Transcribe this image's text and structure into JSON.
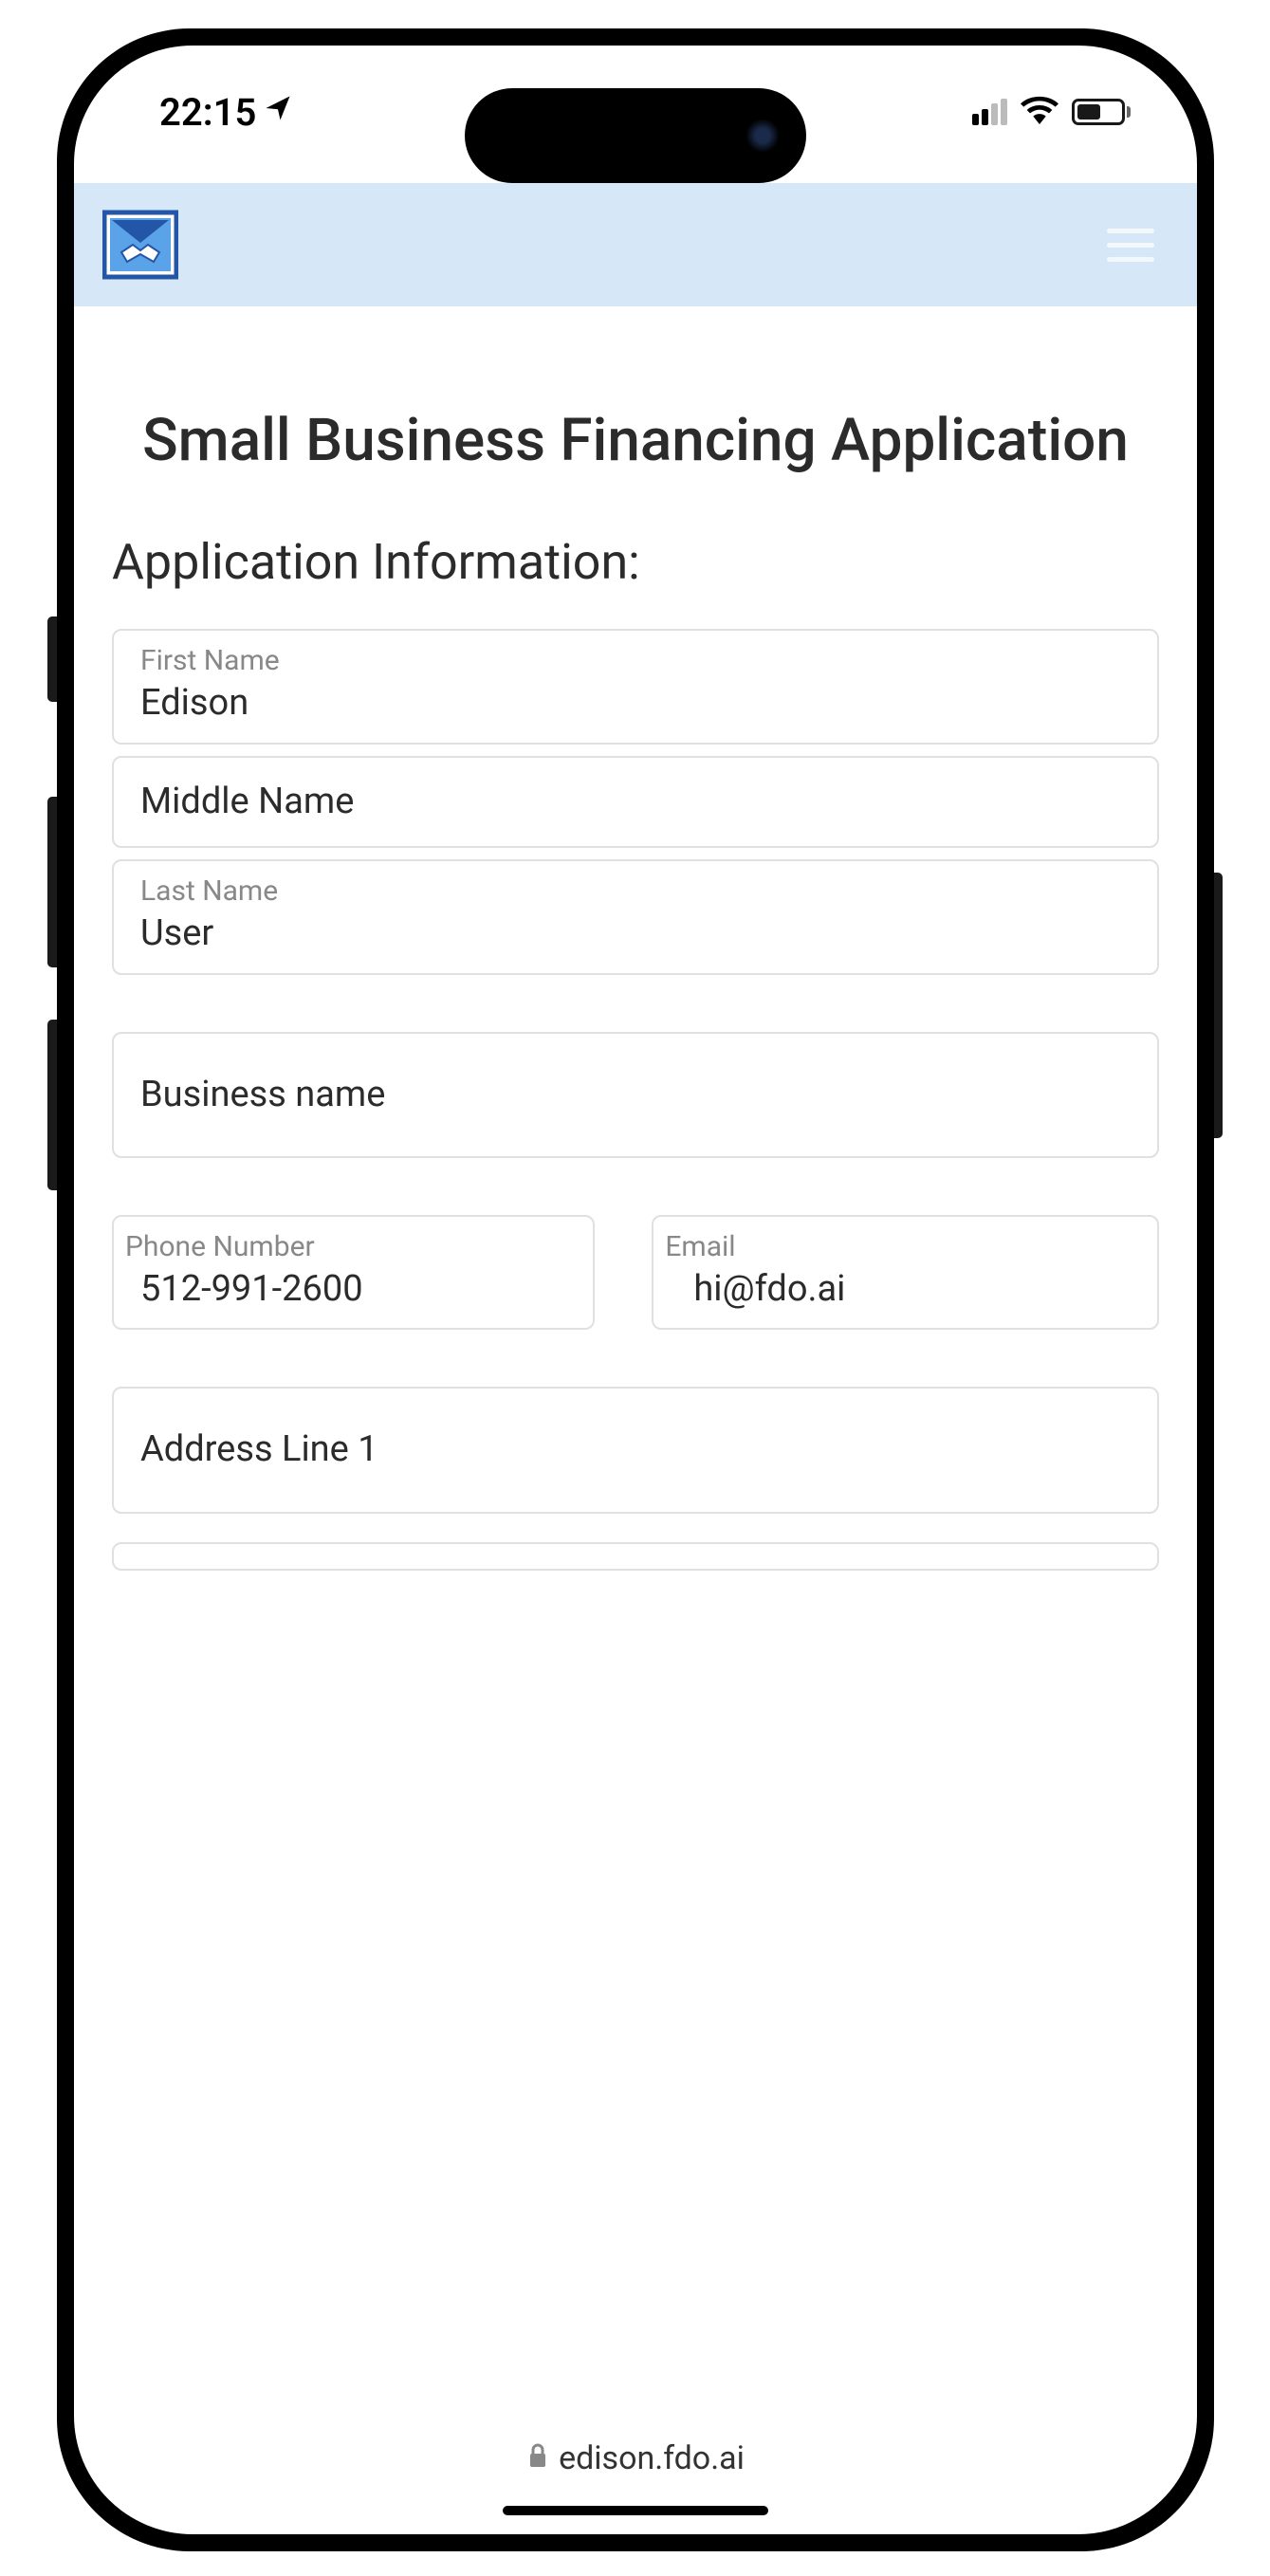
{
  "status": {
    "time": "22:15"
  },
  "page": {
    "title": "Small Business Financing Application",
    "section_title": "Application Information:"
  },
  "form": {
    "first_name": {
      "label": "First Name",
      "value": "Edison"
    },
    "middle_name": {
      "placeholder": "Middle Name",
      "value": ""
    },
    "last_name": {
      "label": "Last Name",
      "value": "User"
    },
    "business_name": {
      "placeholder": "Business name",
      "value": ""
    },
    "phone": {
      "label": "Phone Number",
      "value": "512-991-2600"
    },
    "email": {
      "label": "Email",
      "value": "hi@fdo.ai"
    },
    "address1": {
      "placeholder": "Address Line 1",
      "value": ""
    }
  },
  "browser": {
    "url": "edison.fdo.ai"
  }
}
